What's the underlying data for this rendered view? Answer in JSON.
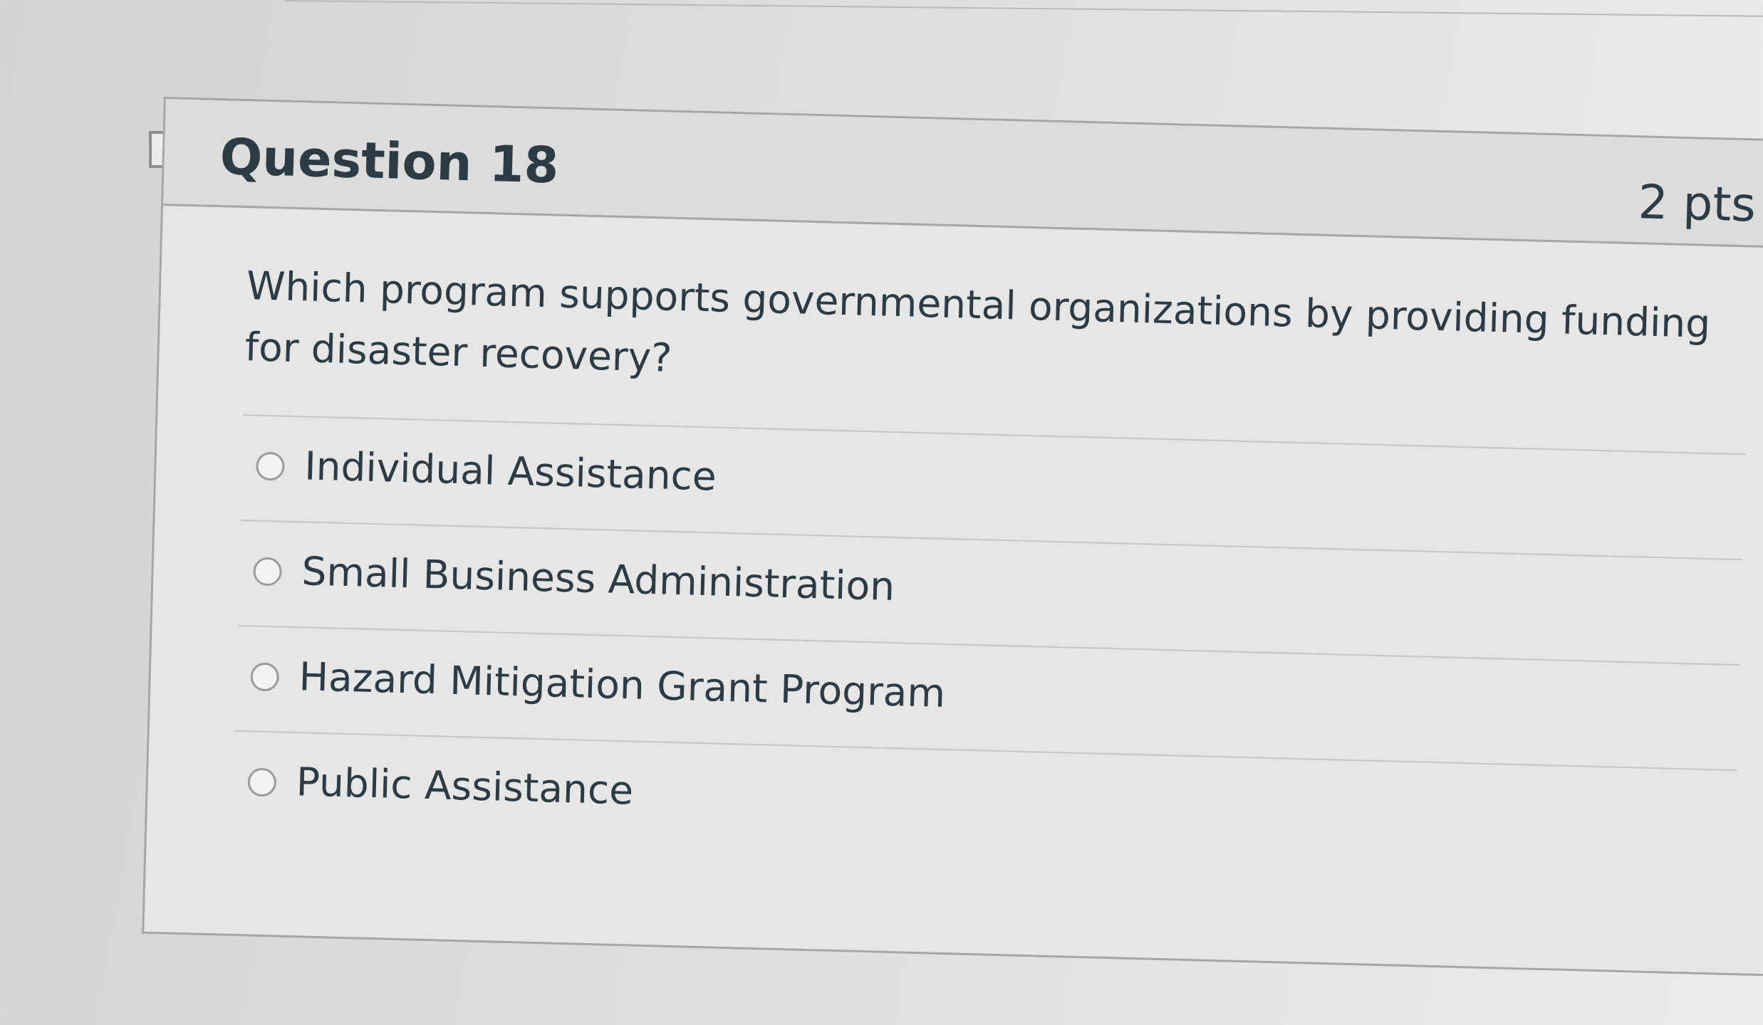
{
  "question": {
    "title": "Question 18",
    "points": "2 pts",
    "text": "Which program supports governmental organizations by providing funding for disaster recovery?",
    "answers": [
      {
        "label": "Individual Assistance",
        "selected": false
      },
      {
        "label": "Small Business Administration",
        "selected": false
      },
      {
        "label": "Hazard Mitigation Grant Program",
        "selected": false
      },
      {
        "label": "Public Assistance",
        "selected": false
      }
    ]
  },
  "colors": {
    "text": "#2d3b45",
    "border": "#a6a6a8",
    "background": "#e6e6e7"
  },
  "icons": {
    "flag": "bookmark-flag-icon",
    "radio": "radio-button-icon"
  }
}
